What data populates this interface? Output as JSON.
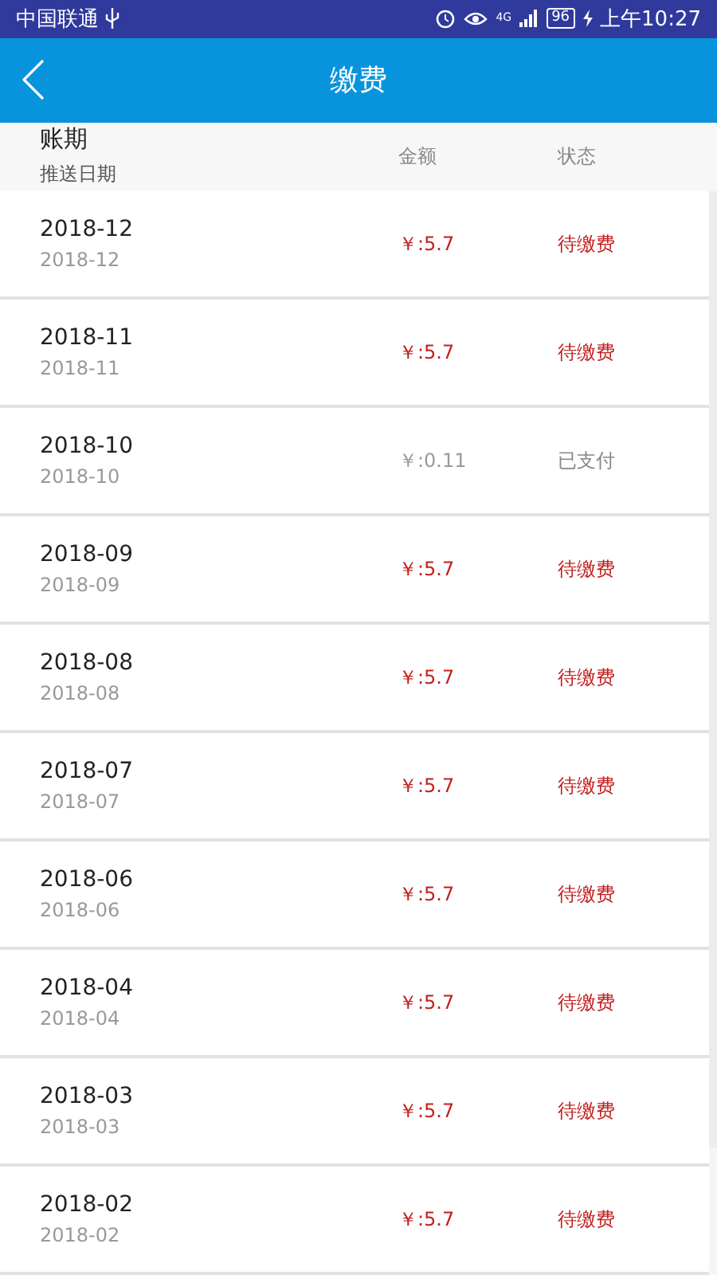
{
  "status_bar": {
    "carrier": "中国联通",
    "network": "4G",
    "battery": "96",
    "time": "上午10:27"
  },
  "nav": {
    "title": "缴费"
  },
  "header": {
    "period": "账期",
    "push_date": "推送日期",
    "amount": "金额",
    "status": "状态"
  },
  "rows": [
    {
      "period": "2018-12",
      "date": "2018-12",
      "amount": "￥:5.7",
      "status": "待缴费",
      "paid": false
    },
    {
      "period": "2018-11",
      "date": "2018-11",
      "amount": "￥:5.7",
      "status": "待缴费",
      "paid": false
    },
    {
      "period": "2018-10",
      "date": "2018-10",
      "amount": "￥:0.11",
      "status": "已支付",
      "paid": true
    },
    {
      "period": "2018-09",
      "date": "2018-09",
      "amount": "￥:5.7",
      "status": "待缴费",
      "paid": false
    },
    {
      "period": "2018-08",
      "date": "2018-08",
      "amount": "￥:5.7",
      "status": "待缴费",
      "paid": false
    },
    {
      "period": "2018-07",
      "date": "2018-07",
      "amount": "￥:5.7",
      "status": "待缴费",
      "paid": false
    },
    {
      "period": "2018-06",
      "date": "2018-06",
      "amount": "￥:5.7",
      "status": "待缴费",
      "paid": false
    },
    {
      "period": "2018-04",
      "date": "2018-04",
      "amount": "￥:5.7",
      "status": "待缴费",
      "paid": false
    },
    {
      "period": "2018-03",
      "date": "2018-03",
      "amount": "￥:5.7",
      "status": "待缴费",
      "paid": false
    },
    {
      "period": "2018-02",
      "date": "2018-02",
      "amount": "￥:5.7",
      "status": "待缴费",
      "paid": false
    }
  ]
}
